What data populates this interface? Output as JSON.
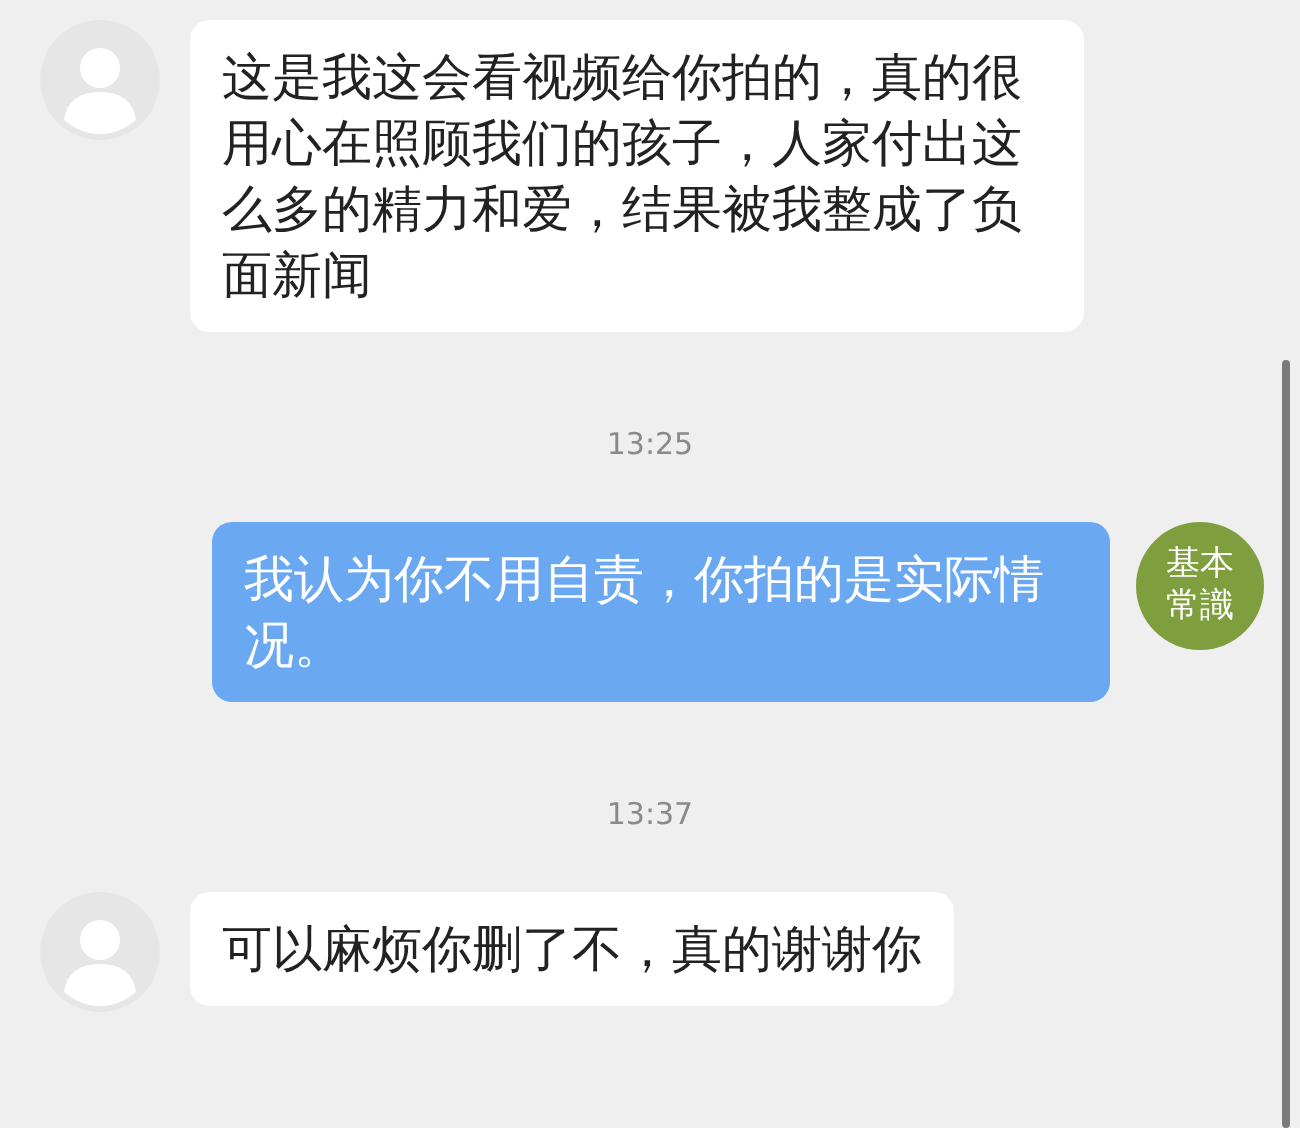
{
  "messages": [
    {
      "kind": "message",
      "outgoing": false,
      "text": "这是我这会看视频给你拍的，真的很用心在照顾我们的孩子，人家付出这么多的精力和爱，结果被我整成了负面新闻"
    },
    {
      "kind": "time",
      "text": "13:25"
    },
    {
      "kind": "message",
      "outgoing": true,
      "text": "我认为你不用自责，你拍的是实际情况。",
      "avatar_text": [
        "基本",
        "常識"
      ]
    },
    {
      "kind": "time",
      "text": "13:37"
    },
    {
      "kind": "message",
      "outgoing": false,
      "text": "可以麻烦你删了不，真的谢谢你"
    }
  ]
}
